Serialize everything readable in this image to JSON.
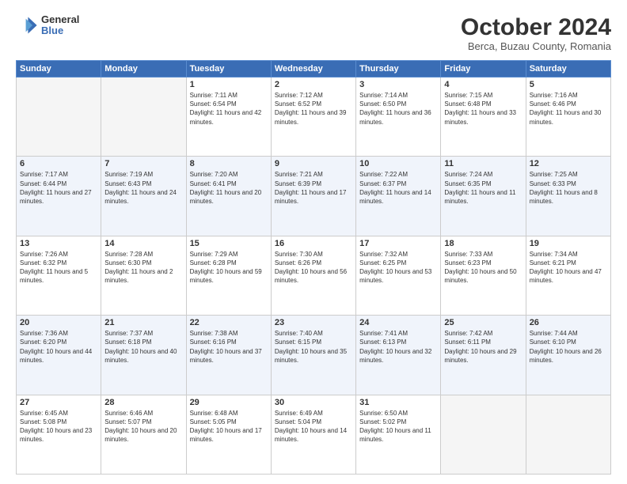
{
  "header": {
    "logo_general": "General",
    "logo_blue": "Blue",
    "month_title": "October 2024",
    "subtitle": "Berca, Buzau County, Romania"
  },
  "weekdays": [
    "Sunday",
    "Monday",
    "Tuesday",
    "Wednesday",
    "Thursday",
    "Friday",
    "Saturday"
  ],
  "weeks": [
    [
      {
        "day": "",
        "sunrise": "",
        "sunset": "",
        "daylight": "",
        "empty": true
      },
      {
        "day": "",
        "sunrise": "",
        "sunset": "",
        "daylight": "",
        "empty": true
      },
      {
        "day": "1",
        "sunrise": "Sunrise: 7:11 AM",
        "sunset": "Sunset: 6:54 PM",
        "daylight": "Daylight: 11 hours and 42 minutes.",
        "empty": false
      },
      {
        "day": "2",
        "sunrise": "Sunrise: 7:12 AM",
        "sunset": "Sunset: 6:52 PM",
        "daylight": "Daylight: 11 hours and 39 minutes.",
        "empty": false
      },
      {
        "day": "3",
        "sunrise": "Sunrise: 7:14 AM",
        "sunset": "Sunset: 6:50 PM",
        "daylight": "Daylight: 11 hours and 36 minutes.",
        "empty": false
      },
      {
        "day": "4",
        "sunrise": "Sunrise: 7:15 AM",
        "sunset": "Sunset: 6:48 PM",
        "daylight": "Daylight: 11 hours and 33 minutes.",
        "empty": false
      },
      {
        "day": "5",
        "sunrise": "Sunrise: 7:16 AM",
        "sunset": "Sunset: 6:46 PM",
        "daylight": "Daylight: 11 hours and 30 minutes.",
        "empty": false
      }
    ],
    [
      {
        "day": "6",
        "sunrise": "Sunrise: 7:17 AM",
        "sunset": "Sunset: 6:44 PM",
        "daylight": "Daylight: 11 hours and 27 minutes.",
        "empty": false
      },
      {
        "day": "7",
        "sunrise": "Sunrise: 7:19 AM",
        "sunset": "Sunset: 6:43 PM",
        "daylight": "Daylight: 11 hours and 24 minutes.",
        "empty": false
      },
      {
        "day": "8",
        "sunrise": "Sunrise: 7:20 AM",
        "sunset": "Sunset: 6:41 PM",
        "daylight": "Daylight: 11 hours and 20 minutes.",
        "empty": false
      },
      {
        "day": "9",
        "sunrise": "Sunrise: 7:21 AM",
        "sunset": "Sunset: 6:39 PM",
        "daylight": "Daylight: 11 hours and 17 minutes.",
        "empty": false
      },
      {
        "day": "10",
        "sunrise": "Sunrise: 7:22 AM",
        "sunset": "Sunset: 6:37 PM",
        "daylight": "Daylight: 11 hours and 14 minutes.",
        "empty": false
      },
      {
        "day": "11",
        "sunrise": "Sunrise: 7:24 AM",
        "sunset": "Sunset: 6:35 PM",
        "daylight": "Daylight: 11 hours and 11 minutes.",
        "empty": false
      },
      {
        "day": "12",
        "sunrise": "Sunrise: 7:25 AM",
        "sunset": "Sunset: 6:33 PM",
        "daylight": "Daylight: 11 hours and 8 minutes.",
        "empty": false
      }
    ],
    [
      {
        "day": "13",
        "sunrise": "Sunrise: 7:26 AM",
        "sunset": "Sunset: 6:32 PM",
        "daylight": "Daylight: 11 hours and 5 minutes.",
        "empty": false
      },
      {
        "day": "14",
        "sunrise": "Sunrise: 7:28 AM",
        "sunset": "Sunset: 6:30 PM",
        "daylight": "Daylight: 11 hours and 2 minutes.",
        "empty": false
      },
      {
        "day": "15",
        "sunrise": "Sunrise: 7:29 AM",
        "sunset": "Sunset: 6:28 PM",
        "daylight": "Daylight: 10 hours and 59 minutes.",
        "empty": false
      },
      {
        "day": "16",
        "sunrise": "Sunrise: 7:30 AM",
        "sunset": "Sunset: 6:26 PM",
        "daylight": "Daylight: 10 hours and 56 minutes.",
        "empty": false
      },
      {
        "day": "17",
        "sunrise": "Sunrise: 7:32 AM",
        "sunset": "Sunset: 6:25 PM",
        "daylight": "Daylight: 10 hours and 53 minutes.",
        "empty": false
      },
      {
        "day": "18",
        "sunrise": "Sunrise: 7:33 AM",
        "sunset": "Sunset: 6:23 PM",
        "daylight": "Daylight: 10 hours and 50 minutes.",
        "empty": false
      },
      {
        "day": "19",
        "sunrise": "Sunrise: 7:34 AM",
        "sunset": "Sunset: 6:21 PM",
        "daylight": "Daylight: 10 hours and 47 minutes.",
        "empty": false
      }
    ],
    [
      {
        "day": "20",
        "sunrise": "Sunrise: 7:36 AM",
        "sunset": "Sunset: 6:20 PM",
        "daylight": "Daylight: 10 hours and 44 minutes.",
        "empty": false
      },
      {
        "day": "21",
        "sunrise": "Sunrise: 7:37 AM",
        "sunset": "Sunset: 6:18 PM",
        "daylight": "Daylight: 10 hours and 40 minutes.",
        "empty": false
      },
      {
        "day": "22",
        "sunrise": "Sunrise: 7:38 AM",
        "sunset": "Sunset: 6:16 PM",
        "daylight": "Daylight: 10 hours and 37 minutes.",
        "empty": false
      },
      {
        "day": "23",
        "sunrise": "Sunrise: 7:40 AM",
        "sunset": "Sunset: 6:15 PM",
        "daylight": "Daylight: 10 hours and 35 minutes.",
        "empty": false
      },
      {
        "day": "24",
        "sunrise": "Sunrise: 7:41 AM",
        "sunset": "Sunset: 6:13 PM",
        "daylight": "Daylight: 10 hours and 32 minutes.",
        "empty": false
      },
      {
        "day": "25",
        "sunrise": "Sunrise: 7:42 AM",
        "sunset": "Sunset: 6:11 PM",
        "daylight": "Daylight: 10 hours and 29 minutes.",
        "empty": false
      },
      {
        "day": "26",
        "sunrise": "Sunrise: 7:44 AM",
        "sunset": "Sunset: 6:10 PM",
        "daylight": "Daylight: 10 hours and 26 minutes.",
        "empty": false
      }
    ],
    [
      {
        "day": "27",
        "sunrise": "Sunrise: 6:45 AM",
        "sunset": "Sunset: 5:08 PM",
        "daylight": "Daylight: 10 hours and 23 minutes.",
        "empty": false
      },
      {
        "day": "28",
        "sunrise": "Sunrise: 6:46 AM",
        "sunset": "Sunset: 5:07 PM",
        "daylight": "Daylight: 10 hours and 20 minutes.",
        "empty": false
      },
      {
        "day": "29",
        "sunrise": "Sunrise: 6:48 AM",
        "sunset": "Sunset: 5:05 PM",
        "daylight": "Daylight: 10 hours and 17 minutes.",
        "empty": false
      },
      {
        "day": "30",
        "sunrise": "Sunrise: 6:49 AM",
        "sunset": "Sunset: 5:04 PM",
        "daylight": "Daylight: 10 hours and 14 minutes.",
        "empty": false
      },
      {
        "day": "31",
        "sunrise": "Sunrise: 6:50 AM",
        "sunset": "Sunset: 5:02 PM",
        "daylight": "Daylight: 10 hours and 11 minutes.",
        "empty": false
      },
      {
        "day": "",
        "sunrise": "",
        "sunset": "",
        "daylight": "",
        "empty": true
      },
      {
        "day": "",
        "sunrise": "",
        "sunset": "",
        "daylight": "",
        "empty": true
      }
    ]
  ]
}
